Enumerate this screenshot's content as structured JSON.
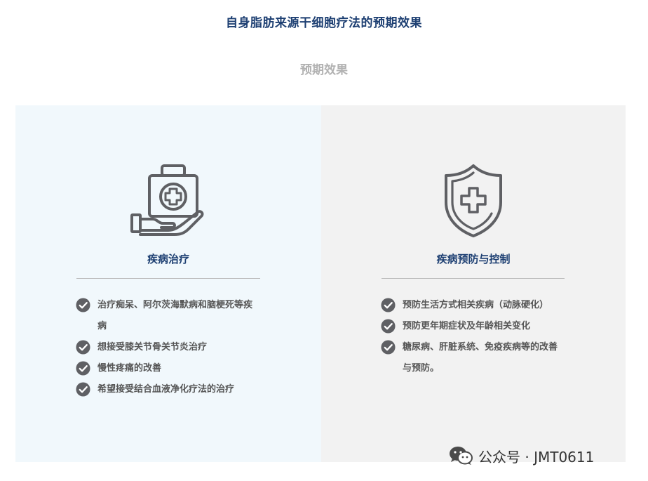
{
  "page": {
    "title": "自身脂肪来源干细胞疗法的预期效果",
    "subtitle": "预期效果"
  },
  "panels": {
    "left": {
      "icon": "medical-kit-hand-icon",
      "heading": "疾病治疗",
      "items": [
        {
          "text": "治疗痴呆、阿尔茨海默病和脑梗死等疾病"
        },
        {
          "text": "想接受膝关节骨关节炎治疗"
        },
        {
          "text": "慢性疼痛的改善"
        },
        {
          "text": "希望接受结合血液净化疗法的治疗"
        }
      ]
    },
    "right": {
      "icon": "shield-cross-icon",
      "heading": "疾病预防与控制",
      "items": [
        {
          "text": "预防生活方式相关疾病（动脉硬化）"
        },
        {
          "text": "预防更年期症状及年龄相关变化"
        },
        {
          "text": "糖尿病、肝脏系统、免疫疾病等的改善与预防。"
        }
      ]
    }
  },
  "watermark": {
    "icon": "wechat-icon",
    "text": "公众号 · JMT0611"
  },
  "colors": {
    "title": "#1d3f72",
    "subtitle": "#b2b2b2",
    "left_panel_bg": "#f1f8fc",
    "right_panel_bg": "#f2f2f2",
    "check": "#5f6064"
  }
}
